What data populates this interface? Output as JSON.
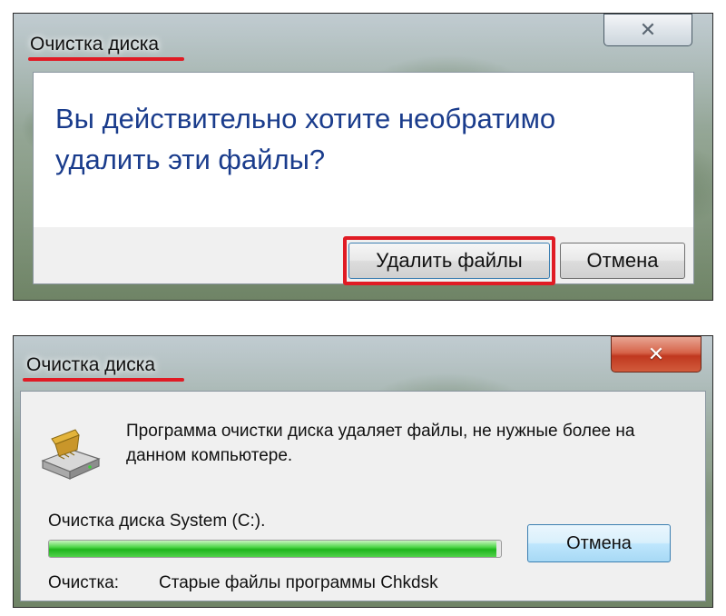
{
  "dialog1": {
    "title": "Очистка диска",
    "close_glyph": "✕",
    "question": "Вы действительно хотите необратимо удалить эти файлы?",
    "delete_button": "Удалить файлы",
    "cancel_button": "Отмена"
  },
  "dialog2": {
    "title": "Очистка диска",
    "close_glyph": "✕",
    "description": "Программа очистки диска удаляет файлы, не нужные более на данном компьютере.",
    "progress_label": "Очистка диска System (C:).",
    "progress_fraction": 0.99,
    "cancel_button": "Отмена",
    "status_label": "Очистка:",
    "status_value": "Старые файлы программы Chkdsk",
    "icon": "disk-cleanup-icon"
  },
  "colors": {
    "highlight_red": "#e01b24",
    "question_blue": "#1a3c8c",
    "progress_green": "#1fb51c"
  }
}
